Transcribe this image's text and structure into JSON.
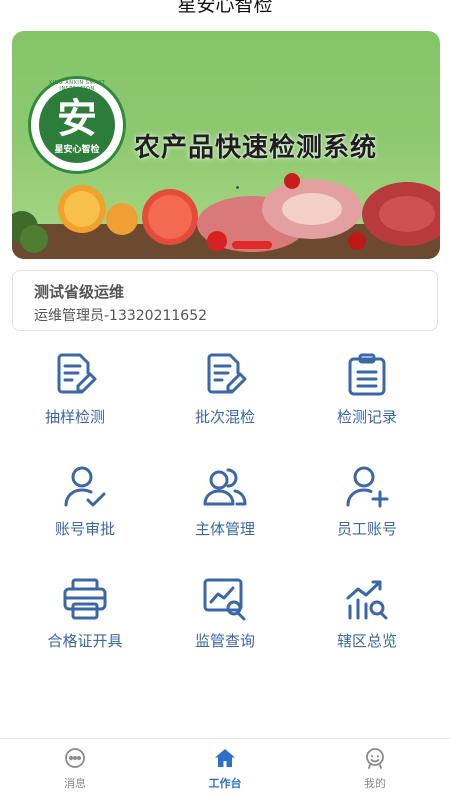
{
  "app": {
    "title": "星安心智检"
  },
  "banner": {
    "title": "农产品快速检测系统",
    "logo_text": "星安心智检",
    "logo_arc_text": "XING ANXIN SMART INSPECTION"
  },
  "user": {
    "name": "测试省级运维",
    "role": "运维管理员-13320211652"
  },
  "grid": {
    "items": [
      {
        "label": "抽样检测",
        "icon": "sampling-icon"
      },
      {
        "label": "批次混检",
        "icon": "batch-test-icon"
      },
      {
        "label": "检测记录",
        "icon": "clipboard-record-icon"
      },
      {
        "label": "账号审批",
        "icon": "user-approve-icon"
      },
      {
        "label": "主体管理",
        "icon": "users-manage-icon"
      },
      {
        "label": "员工账号",
        "icon": "user-add-icon"
      },
      {
        "label": "合格证开具",
        "icon": "printer-icon"
      },
      {
        "label": "监管查询",
        "icon": "chart-search-icon"
      },
      {
        "label": "辖区总览",
        "icon": "area-overview-icon"
      }
    ]
  },
  "tabbar": {
    "items": [
      {
        "label": "消息",
        "icon": "message-icon",
        "active": false
      },
      {
        "label": "工作台",
        "icon": "home-icon",
        "active": true
      },
      {
        "label": "我的",
        "icon": "profile-icon",
        "active": false
      }
    ]
  },
  "colors": {
    "primary": "#3a67a8",
    "tab_active": "#2f6fc9",
    "tab_inactive": "#8a8a8a"
  }
}
